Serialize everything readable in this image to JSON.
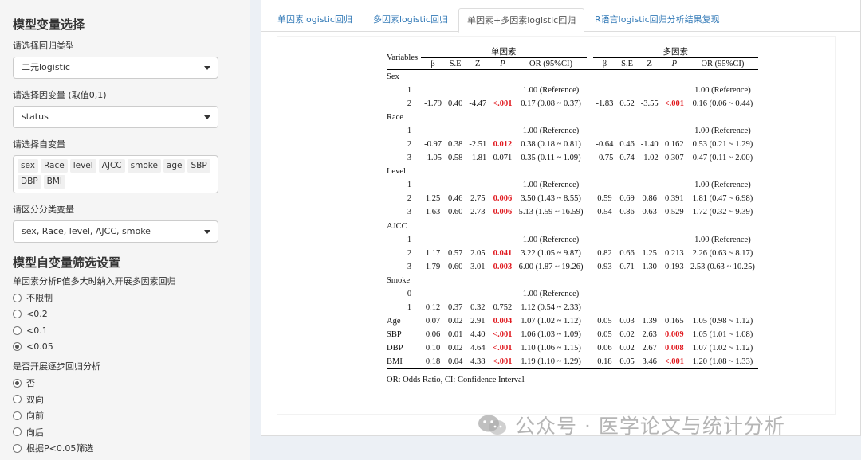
{
  "sidebar": {
    "section1_title": "模型变量选择",
    "reg_type_label": "请选择回归类型",
    "reg_type_value": "二元logistic",
    "dep_var_label": "请选择因变量 (取值0,1)",
    "dep_var_value": "status",
    "indep_var_label": "请选择自变量",
    "indep_vars": [
      "sex",
      "Race",
      "level",
      "AJCC",
      "smoke",
      "age",
      "SBP",
      "DBP",
      "BMI"
    ],
    "cat_var_label": "请区分分类变量",
    "cat_var_value": "sex, Race, level, AJCC, smoke",
    "section2_title": "模型自变量筛选设置",
    "p_label": "单因素分析P值多大时纳入开展多因素回归",
    "p_options": [
      {
        "label": "不限制",
        "selected": false
      },
      {
        "label": "<0.2",
        "selected": false
      },
      {
        "label": "<0.1",
        "selected": false
      },
      {
        "label": "<0.05",
        "selected": true
      }
    ],
    "stepwise_label": "是否开展逐步回归分析",
    "stepwise_options": [
      {
        "label": "否",
        "selected": true
      },
      {
        "label": "双向",
        "selected": false
      },
      {
        "label": "向前",
        "selected": false
      },
      {
        "label": "向后",
        "selected": false
      },
      {
        "label": "根据P<0.05筛选",
        "selected": false
      }
    ]
  },
  "tabs": [
    {
      "label": "单因素logistic回归",
      "active": false
    },
    {
      "label": "多因素logistic回归",
      "active": false
    },
    {
      "label": "单因素+多因素logistic回归",
      "active": true
    },
    {
      "label": "R语言logistic回归分析结果复现",
      "active": false
    }
  ],
  "table": {
    "variables_header": "Variables",
    "group_uni": "单因素",
    "group_multi": "多因素",
    "sub_headers": [
      "β",
      "S.E",
      "Z",
      "P",
      "OR (95%CI)"
    ],
    "rows": [
      {
        "label": "Sex",
        "type": "var"
      },
      {
        "label": "1",
        "type": "lvl",
        "uni": [
          "",
          "",
          "",
          "",
          "1.00 (Reference)"
        ],
        "multi": [
          "",
          "",
          "",
          "",
          "1.00 (Reference)"
        ]
      },
      {
        "label": "2",
        "type": "lvl",
        "uni": [
          "-1.79",
          "0.40",
          "-4.47",
          "<.001",
          "0.17 (0.08 ~ 0.37)"
        ],
        "multi": [
          "-1.83",
          "0.52",
          "-3.55",
          "<.001",
          "0.16 (0.06 ~ 0.44)"
        ],
        "sig_uni": true,
        "sig_multi": true
      },
      {
        "label": "Race",
        "type": "var"
      },
      {
        "label": "1",
        "type": "lvl",
        "uni": [
          "",
          "",
          "",
          "",
          "1.00 (Reference)"
        ],
        "multi": [
          "",
          "",
          "",
          "",
          "1.00 (Reference)"
        ]
      },
      {
        "label": "2",
        "type": "lvl",
        "uni": [
          "-0.97",
          "0.38",
          "-2.51",
          "0.012",
          "0.38 (0.18 ~ 0.81)"
        ],
        "multi": [
          "-0.64",
          "0.46",
          "-1.40",
          "0.162",
          "0.53 (0.21 ~ 1.29)"
        ],
        "sig_uni": true,
        "sig_multi": false
      },
      {
        "label": "3",
        "type": "lvl",
        "uni": [
          "-1.05",
          "0.58",
          "-1.81",
          "0.071",
          "0.35 (0.11 ~ 1.09)"
        ],
        "multi": [
          "-0.75",
          "0.74",
          "-1.02",
          "0.307",
          "0.47 (0.11 ~ 2.00)"
        ],
        "sig_uni": false,
        "sig_multi": false
      },
      {
        "label": "Level",
        "type": "var"
      },
      {
        "label": "1",
        "type": "lvl",
        "uni": [
          "",
          "",
          "",
          "",
          "1.00 (Reference)"
        ],
        "multi": [
          "",
          "",
          "",
          "",
          "1.00 (Reference)"
        ]
      },
      {
        "label": "2",
        "type": "lvl",
        "uni": [
          "1.25",
          "0.46",
          "2.75",
          "0.006",
          "3.50 (1.43 ~ 8.55)"
        ],
        "multi": [
          "0.59",
          "0.69",
          "0.86",
          "0.391",
          "1.81 (0.47 ~ 6.98)"
        ],
        "sig_uni": true,
        "sig_multi": false
      },
      {
        "label": "3",
        "type": "lvl",
        "uni": [
          "1.63",
          "0.60",
          "2.73",
          "0.006",
          "5.13 (1.59 ~ 16.59)"
        ],
        "multi": [
          "0.54",
          "0.86",
          "0.63",
          "0.529",
          "1.72 (0.32 ~ 9.39)"
        ],
        "sig_uni": true,
        "sig_multi": false
      },
      {
        "label": "AJCC",
        "type": "var"
      },
      {
        "label": "1",
        "type": "lvl",
        "uni": [
          "",
          "",
          "",
          "",
          "1.00 (Reference)"
        ],
        "multi": [
          "",
          "",
          "",
          "",
          "1.00 (Reference)"
        ]
      },
      {
        "label": "2",
        "type": "lvl",
        "uni": [
          "1.17",
          "0.57",
          "2.05",
          "0.041",
          "3.22 (1.05 ~ 9.87)"
        ],
        "multi": [
          "0.82",
          "0.66",
          "1.25",
          "0.213",
          "2.26 (0.63 ~ 8.17)"
        ],
        "sig_uni": true,
        "sig_multi": false
      },
      {
        "label": "3",
        "type": "lvl",
        "uni": [
          "1.79",
          "0.60",
          "3.01",
          "0.003",
          "6.00 (1.87 ~ 19.26)"
        ],
        "multi": [
          "0.93",
          "0.71",
          "1.30",
          "0.193",
          "2.53 (0.63 ~ 10.25)"
        ],
        "sig_uni": true,
        "sig_multi": false
      },
      {
        "label": "Smoke",
        "type": "var"
      },
      {
        "label": "0",
        "type": "lvl",
        "uni": [
          "",
          "",
          "",
          "",
          "1.00 (Reference)"
        ],
        "multi": [
          "",
          "",
          "",
          "",
          ""
        ]
      },
      {
        "label": "1",
        "type": "lvl",
        "uni": [
          "0.12",
          "0.37",
          "0.32",
          "0.752",
          "1.12 (0.54 ~ 2.33)"
        ],
        "multi": [
          "",
          "",
          "",
          "",
          ""
        ],
        "sig_uni": false,
        "sig_multi": false
      },
      {
        "label": "Age",
        "type": "cont",
        "uni": [
          "0.07",
          "0.02",
          "2.91",
          "0.004",
          "1.07 (1.02 ~ 1.12)"
        ],
        "multi": [
          "0.05",
          "0.03",
          "1.39",
          "0.165",
          "1.05 (0.98 ~ 1.12)"
        ],
        "sig_uni": true,
        "sig_multi": false
      },
      {
        "label": "SBP",
        "type": "cont",
        "uni": [
          "0.06",
          "0.01",
          "4.40",
          "<.001",
          "1.06 (1.03 ~ 1.09)"
        ],
        "multi": [
          "0.05",
          "0.02",
          "2.63",
          "0.009",
          "1.05 (1.01 ~ 1.08)"
        ],
        "sig_uni": true,
        "sig_multi": true
      },
      {
        "label": "DBP",
        "type": "cont",
        "uni": [
          "0.10",
          "0.02",
          "4.64",
          "<.001",
          "1.10 (1.06 ~ 1.15)"
        ],
        "multi": [
          "0.06",
          "0.02",
          "2.67",
          "0.008",
          "1.07 (1.02 ~ 1.12)"
        ],
        "sig_uni": true,
        "sig_multi": true
      },
      {
        "label": "BMI",
        "type": "cont",
        "uni": [
          "0.18",
          "0.04",
          "4.38",
          "<.001",
          "1.19 (1.10 ~ 1.29)"
        ],
        "multi": [
          "0.18",
          "0.05",
          "3.46",
          "<.001",
          "1.20 (1.08 ~ 1.33)"
        ],
        "sig_uni": true,
        "sig_multi": true
      }
    ],
    "footnote": "OR: Odds Ratio, CI: Confidence Interval"
  },
  "watermark": {
    "text": "公众号 · 医学论文与统计分析"
  }
}
